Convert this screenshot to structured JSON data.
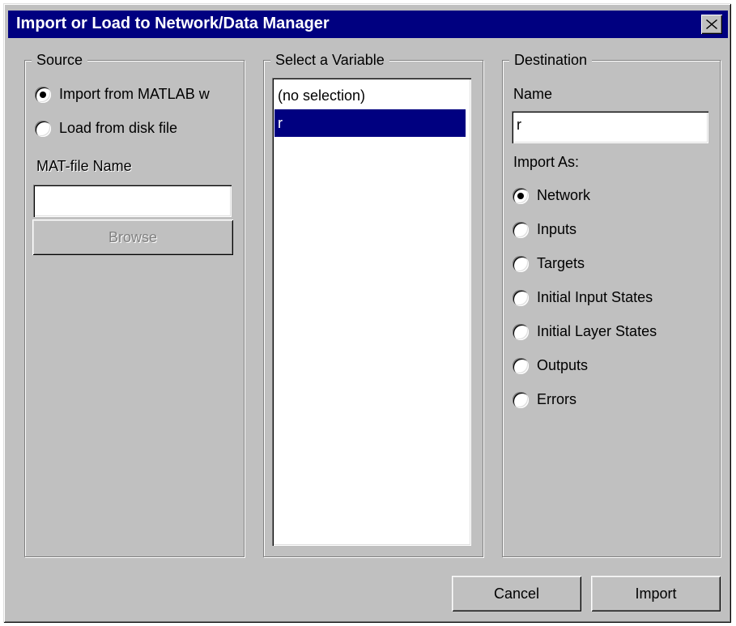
{
  "window": {
    "title": "Import or Load to Network/Data Manager"
  },
  "source": {
    "legend": "Source",
    "options": [
      {
        "label": "Import from MATLAB w",
        "checked": true
      },
      {
        "label": "Load from disk file",
        "checked": false
      }
    ],
    "mat_file_label": "MAT-file Name",
    "mat_file_value": "",
    "browse_label": "Browse"
  },
  "variable": {
    "legend": "Select a Variable",
    "items": [
      {
        "label": "(no selection)",
        "selected": false
      },
      {
        "label": "r",
        "selected": true
      }
    ]
  },
  "destination": {
    "legend": "Destination",
    "name_label": "Name",
    "name_value": "r",
    "import_as_label": "Import As:",
    "options": [
      {
        "label": "Network",
        "checked": true
      },
      {
        "label": "Inputs",
        "checked": false
      },
      {
        "label": "Targets",
        "checked": false
      },
      {
        "label": "Initial Input States",
        "checked": false
      },
      {
        "label": "Initial Layer States",
        "checked": false
      },
      {
        "label": "Outputs",
        "checked": false
      },
      {
        "label": "Errors",
        "checked": false
      }
    ]
  },
  "buttons": {
    "cancel": "Cancel",
    "import": "Import"
  }
}
